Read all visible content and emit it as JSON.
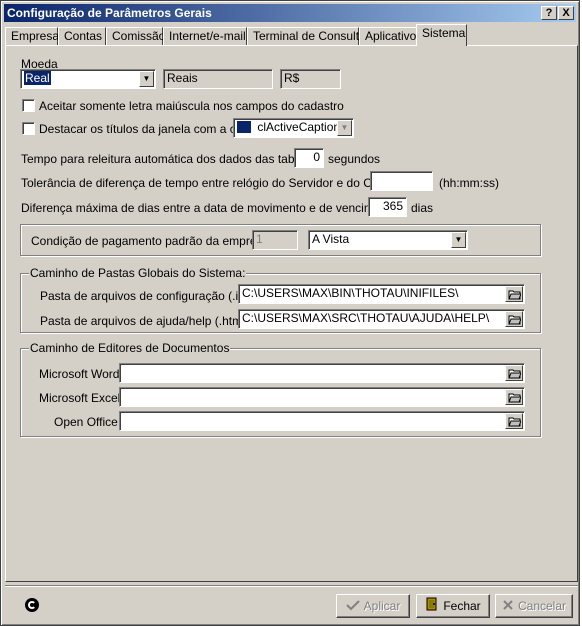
{
  "window": {
    "title": "Configuração de Parâmetros Gerais",
    "help_button": "?",
    "close_button": "X"
  },
  "tabs": [
    {
      "label": "Empresa"
    },
    {
      "label": "Contas"
    },
    {
      "label": "Comissão"
    },
    {
      "label": "Internet/e-mail"
    },
    {
      "label": "Terminal de Consulta"
    },
    {
      "label": "Aplicativo"
    },
    {
      "label": "Sistema",
      "active": true
    }
  ],
  "moeda": {
    "label": "Moeda",
    "selected": "Real",
    "name": "Reais",
    "symbol": "R$"
  },
  "options": {
    "uppercase_label": "Aceitar somente letra maiúscula nos campos do cadastro",
    "uppercase_checked": false,
    "highlight_label": "Destacar os títulos da janela com a cor:",
    "highlight_checked": false,
    "color_value": "clActiveCaption",
    "color_swatch": "#0a246a"
  },
  "reload": {
    "label": "Tempo para releitura automática dos dados das tabelas:",
    "value": "0",
    "unit": "segundos"
  },
  "tolerance": {
    "label": "Tolerância de diferença de tempo entre relógio do Servidor e do Cliente:",
    "value": "",
    "unit": "(hh:mm:ss)"
  },
  "max_days": {
    "label": "Diferença máxima de dias entre a data de movimento e de vencimento:",
    "value": "365",
    "unit": "dias"
  },
  "payment": {
    "label": "Condição de pagamento padrão da empresa:",
    "code": "1",
    "value": "A Vista"
  },
  "global_paths": {
    "title": "Caminho de Pastas Globais do Sistema:",
    "config_label": "Pasta de arquivos de configuração (.ini):",
    "config_value": "C:\\USERS\\MAX\\BIN\\THOTAU\\INIFILES\\",
    "help_label": "Pasta de arquivos de ajuda/help (.html):",
    "help_value": "C:\\USERS\\MAX\\SRC\\THOTAU\\AJUDA\\HELP\\"
  },
  "editors": {
    "title": "Caminho de Editores de Documentos",
    "word_label": "Microsoft Word:",
    "word_value": "",
    "excel_label": "Microsoft Excel:",
    "excel_value": "",
    "office_label": "Open Office:",
    "office_value": ""
  },
  "footer": {
    "apply_label": "Aplicar",
    "close_label": "Fechar",
    "cancel_label": "Cancelar"
  }
}
